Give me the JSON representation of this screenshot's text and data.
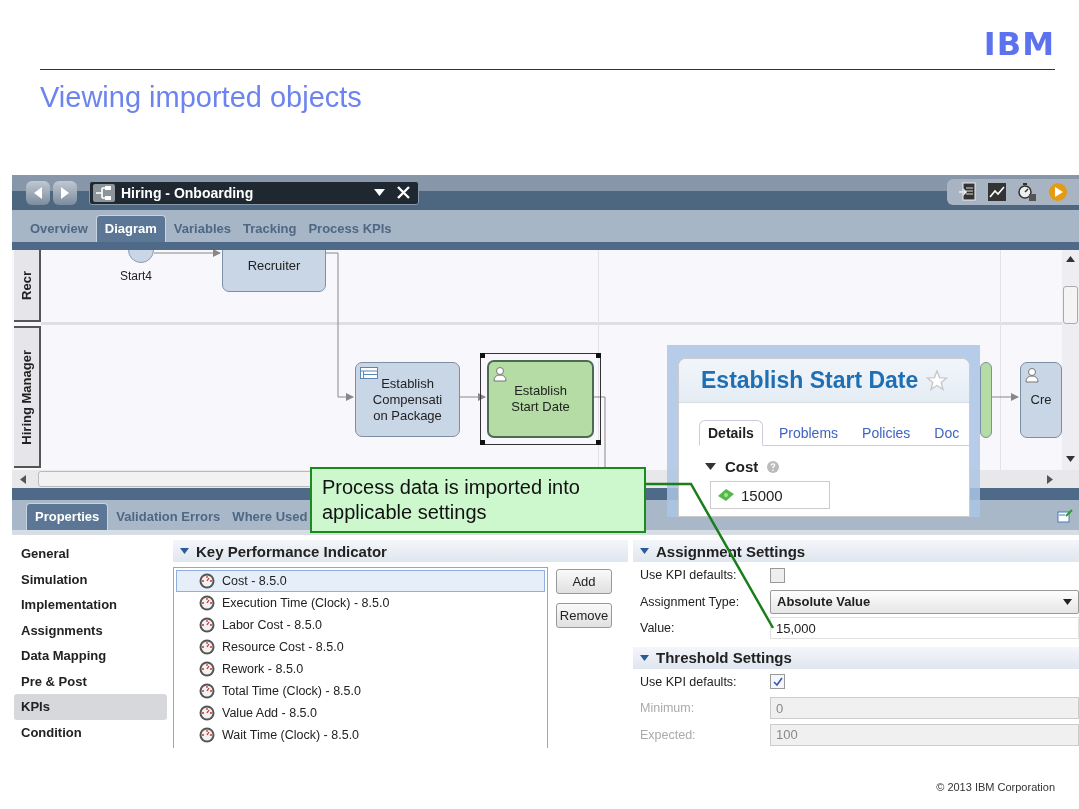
{
  "slide": {
    "logo": "IBM",
    "title": "Viewing imported objects",
    "footer": "© 2013 IBM Corporation"
  },
  "editor": {
    "title": "Hiring - Onboarding"
  },
  "tabs": [
    {
      "label": "Overview",
      "selected": false
    },
    {
      "label": "Diagram",
      "selected": true
    },
    {
      "label": "Variables",
      "selected": false
    },
    {
      "label": "Tracking",
      "selected": false
    },
    {
      "label": "Process KPIs",
      "selected": false
    }
  ],
  "diagram": {
    "lanes": [
      {
        "label": "Recr"
      },
      {
        "label": "Hiring Manager"
      }
    ],
    "nodes": [
      {
        "kind": "start",
        "lines": [
          "Start4"
        ],
        "color": "#c9d6e6",
        "selected": false
      },
      {
        "kind": "task",
        "lines": [
          "Recruiter"
        ],
        "color": "#c9d6e6",
        "selected": false
      },
      {
        "kind": "system_task",
        "lines": [
          "Establish",
          "Compensati",
          "on Package"
        ],
        "color": "#c9d6e6",
        "selected": false
      },
      {
        "kind": "user_task",
        "lines": [
          "Establish",
          "Start Date"
        ],
        "color": "#b4dca4",
        "selected": true
      },
      {
        "kind": "task",
        "color": "#b4dca4",
        "selected": false
      },
      {
        "kind": "user_task",
        "lines": [
          "Cre"
        ],
        "color": "#c9d6e6",
        "selected": false
      }
    ]
  },
  "bottom_tabs": [
    {
      "label": "Properties",
      "selected": true
    },
    {
      "label": "Validation Errors",
      "selected": false
    },
    {
      "label": "Where Used",
      "selected": false
    }
  ],
  "properties": {
    "sections": [
      {
        "label": "General",
        "selected": false
      },
      {
        "label": "Simulation",
        "selected": false
      },
      {
        "label": "Implementation",
        "selected": false
      },
      {
        "label": "Assignments",
        "selected": false
      },
      {
        "label": "Data Mapping",
        "selected": false
      },
      {
        "label": "Pre & Post",
        "selected": false
      },
      {
        "label": "KPIs",
        "selected": true
      },
      {
        "label": "Condition",
        "selected": false
      }
    ]
  },
  "kpi": {
    "title": "Key Performance Indicator",
    "items": [
      {
        "label": "Cost - 8.5.0",
        "selected": true
      },
      {
        "label": "Execution Time (Clock) - 8.5.0",
        "selected": false
      },
      {
        "label": "Labor Cost - 8.5.0",
        "selected": false
      },
      {
        "label": "Resource Cost - 8.5.0",
        "selected": false
      },
      {
        "label": "Rework - 8.5.0",
        "selected": false
      },
      {
        "label": "Total Time (Clock) - 8.5.0",
        "selected": false
      },
      {
        "label": "Value Add - 8.5.0",
        "selected": false
      },
      {
        "label": "Wait Time (Clock) - 8.5.0",
        "selected": false
      }
    ],
    "buttons": [
      "Add",
      "Remove"
    ]
  },
  "settings": [
    {
      "title": "Assignment Settings",
      "fields": [
        {
          "kind": "checkbox",
          "label": "Use KPI defaults:",
          "checked": false,
          "disabled": false
        },
        {
          "kind": "select",
          "label": "Assignment Type:",
          "value": "Absolute Value",
          "disabled": false
        },
        {
          "kind": "text",
          "label": "Value:",
          "value": "15,000",
          "disabled": false
        }
      ]
    },
    {
      "title": "Threshold Settings",
      "fields": [
        {
          "kind": "checkbox",
          "label": "Use KPI defaults:",
          "checked": true,
          "disabled": false
        },
        {
          "kind": "text",
          "label": "Minimum:",
          "value": "0",
          "disabled": true
        },
        {
          "kind": "text",
          "label": "Expected:",
          "value": "100",
          "disabled": true
        }
      ]
    }
  ],
  "inset": {
    "title": "Establish Start Date",
    "tabs": [
      {
        "label": "Details",
        "selected": true
      },
      {
        "label": "Problems",
        "selected": false
      },
      {
        "label": "Policies",
        "selected": false
      },
      {
        "label": "Doc",
        "selected": false
      }
    ],
    "section": "Cost",
    "value": "15000"
  },
  "callout": {
    "text": "Process data is imported into applicable settings"
  }
}
